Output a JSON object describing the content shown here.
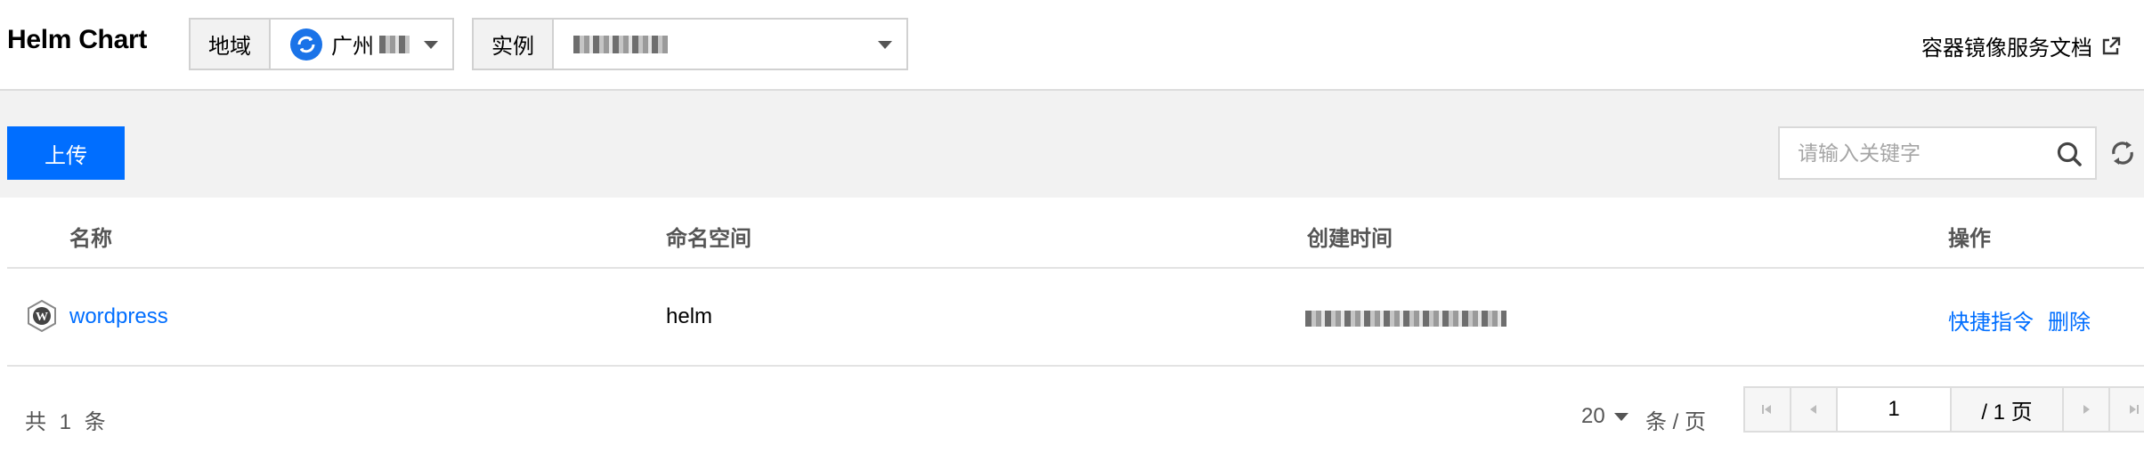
{
  "header": {
    "title": "Helm Chart",
    "region_label": "地域",
    "region_value": "广州",
    "instance_label": "实例",
    "doc_link": "容器镜像服务文档"
  },
  "toolbar": {
    "upload_label": "上传",
    "search_placeholder": "请输入关键字"
  },
  "table": {
    "columns": [
      "名称",
      "命名空间",
      "创建时间",
      "操作"
    ],
    "rows": [
      {
        "name": "wordpress",
        "namespace": "helm",
        "created": "",
        "actions": [
          "快捷指令",
          "删除"
        ]
      }
    ]
  },
  "pagination": {
    "total_text": "共 1 条",
    "page_size": "20",
    "per_page_text": "条 / 页",
    "current_page": "1",
    "total_pages_text": "/ 1 页"
  },
  "colors": {
    "primary": "#006eff",
    "band": "#f2f2f2"
  }
}
